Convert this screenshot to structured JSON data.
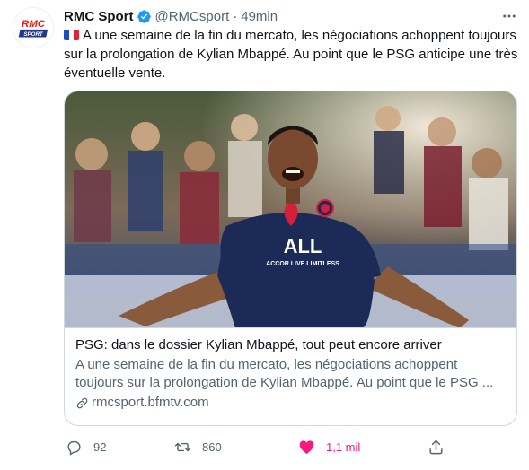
{
  "author": {
    "name": "RMC Sport",
    "handle": "@RMCsport",
    "separator": "·",
    "time": "49min",
    "avatar_text_top": "RMC",
    "avatar_text_bottom": "SPORT"
  },
  "tweet": {
    "flag_icon": "france-flag-icon",
    "text": "A une semaine de la fin du mercato, les négociations achoppent toujours sur la prolongation de Kylian Mbappé. Au point que le PSG anticipe une très éventuelle vente."
  },
  "card": {
    "image_description_icon": "player-celebration-image",
    "jersey_sponsor_top": "ALL",
    "jersey_sponsor_bottom": "ACCOR LIVE LIMITLESS",
    "title": "PSG: dans le dossier Kylian Mbappé, tout peut encore arriver",
    "description": "A une semaine de la fin du mercato, les négociations achoppent toujours sur la prolongation de Kylian Mbappé. Au point que le PSG ...",
    "domain": "rmcsport.bfmtv.com"
  },
  "actions": {
    "replies": "92",
    "retweets": "860",
    "likes": "1,1 mil"
  },
  "colors": {
    "verified": "#1d9bf0",
    "like_active": "#f91880",
    "secondary_text": "#536471",
    "border": "#cfd9de",
    "psg_navy": "#1c2a57",
    "psg_red": "#d6203b"
  }
}
